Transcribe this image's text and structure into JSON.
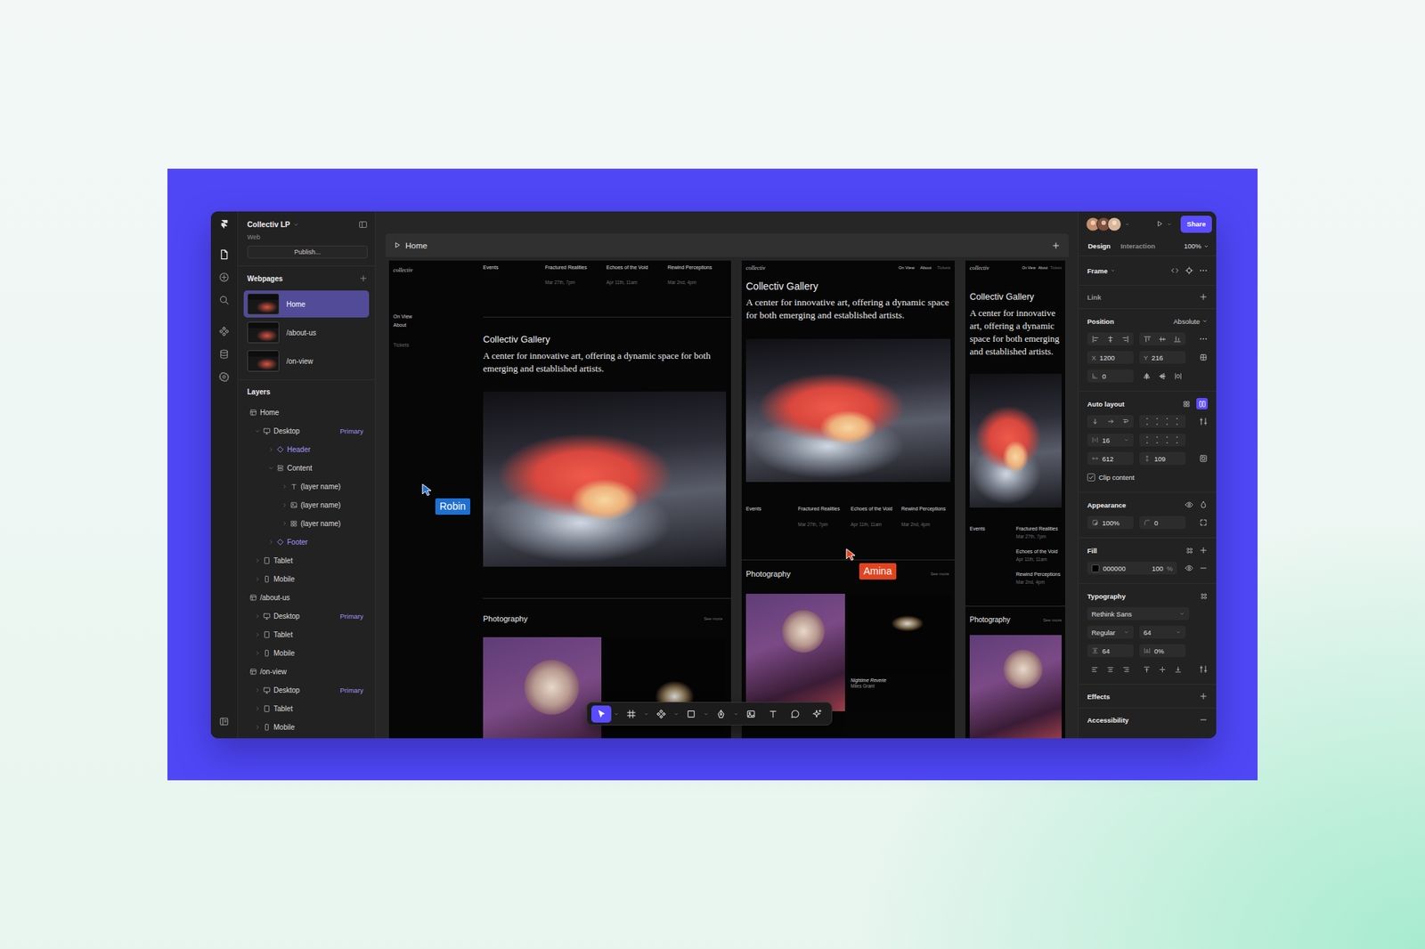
{
  "project": {
    "name": "Collectiv LP",
    "type": "Web",
    "publish": "Publish..."
  },
  "rail": [
    {
      "kind": "pages",
      "selected": true
    },
    {
      "kind": "insert",
      "selected": false
    },
    {
      "kind": "search",
      "selected": false
    },
    {
      "kind": "components",
      "selected": false
    },
    {
      "kind": "cms",
      "selected": false
    },
    {
      "kind": "settings",
      "selected": false
    },
    {
      "kind": "docs",
      "selected": false
    }
  ],
  "webpages": {
    "title": "Webpages",
    "pages": [
      {
        "name": "Home",
        "selected": true
      },
      {
        "name": "/about-us",
        "selected": false
      },
      {
        "name": "/on-view",
        "selected": false
      }
    ]
  },
  "layers": {
    "title": "Layers",
    "items": [
      {
        "name": "Home",
        "kind": "page",
        "depth": 0,
        "expanded": true,
        "tag": ""
      },
      {
        "name": "Desktop",
        "kind": "desktop",
        "depth": 1,
        "expanded": true,
        "tag": "Primary"
      },
      {
        "name": "Header",
        "kind": "component",
        "depth": 2,
        "expanded": false,
        "tag": ""
      },
      {
        "name": "Content",
        "kind": "stack",
        "depth": 2,
        "expanded": true,
        "tag": ""
      },
      {
        "name": "(layer name)",
        "kind": "text",
        "depth": 3,
        "expanded": false,
        "tag": ""
      },
      {
        "name": "(layer name)",
        "kind": "image",
        "depth": 3,
        "expanded": false,
        "tag": ""
      },
      {
        "name": "(layer name)",
        "kind": "grid",
        "depth": 3,
        "expanded": false,
        "tag": ""
      },
      {
        "name": "Footer",
        "kind": "component",
        "depth": 2,
        "expanded": false,
        "tag": ""
      },
      {
        "name": "Tablet",
        "kind": "tablet",
        "depth": 1,
        "expanded": false,
        "tag": ""
      },
      {
        "name": "Mobile",
        "kind": "mobile",
        "depth": 1,
        "expanded": false,
        "tag": ""
      },
      {
        "name": "/about-us",
        "kind": "page",
        "depth": 0,
        "expanded": true,
        "tag": ""
      },
      {
        "name": "Desktop",
        "kind": "desktop",
        "depth": 1,
        "expanded": false,
        "tag": "Primary"
      },
      {
        "name": "Tablet",
        "kind": "tablet",
        "depth": 1,
        "expanded": false,
        "tag": ""
      },
      {
        "name": "Mobile",
        "kind": "mobile",
        "depth": 1,
        "expanded": false,
        "tag": ""
      },
      {
        "name": "/on-view",
        "kind": "page",
        "depth": 0,
        "expanded": true,
        "tag": ""
      },
      {
        "name": "Desktop",
        "kind": "desktop",
        "depth": 1,
        "expanded": false,
        "tag": "Primary"
      },
      {
        "name": "Tablet",
        "kind": "tablet",
        "depth": 1,
        "expanded": false,
        "tag": ""
      },
      {
        "name": "Mobile",
        "kind": "mobile",
        "depth": 1,
        "expanded": false,
        "tag": ""
      }
    ]
  },
  "canvas": {
    "title": "Home",
    "frames": [
      {
        "kind": "desktop"
      },
      {
        "kind": "tablet"
      },
      {
        "kind": "mobile"
      }
    ],
    "site": {
      "logo": "collectiv",
      "nav": [
        {
          "label": "On View",
          "muted": false
        },
        {
          "label": "About",
          "muted": false
        },
        {
          "label": "Tickets",
          "muted": true
        }
      ],
      "title": "Collectiv Gallery",
      "tagline": "A center for innovative art, offering a dynamic space for both emerging and established artists.",
      "events_label": "Events",
      "events": [
        {
          "title": "Fractured Realities",
          "date": "Mar 27th, 7pm"
        },
        {
          "title": "Echoes of the Void",
          "date": "Apr 11th, 11am"
        },
        {
          "title": "Rewind Perceptions",
          "date": "Mar 2nd, 4pm"
        }
      ],
      "section": "Photography",
      "more": "See more",
      "caption": {
        "title": "Nightime Reverie",
        "artist": "Miles Grant"
      }
    },
    "cursors": [
      {
        "name": "Robin",
        "color": "#1f6fd1"
      },
      {
        "name": "Amina",
        "color": "#e2431f"
      }
    ],
    "tools": [
      {
        "kind": "select",
        "selected": true,
        "menu": true
      },
      {
        "kind": "frame",
        "selected": false,
        "menu": true
      },
      {
        "kind": "component",
        "selected": false,
        "menu": true
      },
      {
        "kind": "shape",
        "selected": false,
        "menu": true
      },
      {
        "kind": "pen",
        "selected": false,
        "menu": true
      },
      {
        "kind": "image",
        "selected": false,
        "menu": false
      },
      {
        "kind": "text",
        "selected": false,
        "menu": false
      },
      {
        "kind": "comment",
        "selected": false,
        "menu": false
      },
      {
        "kind": "ai",
        "selected": false,
        "menu": false
      }
    ]
  },
  "inspector": {
    "collaborators": [
      {
        "color": "#c58f6e"
      },
      {
        "color": "#7d4f3c"
      },
      {
        "color": "#d8b69a"
      }
    ],
    "share": "Share",
    "tabs": [
      {
        "label": "Design",
        "selected": true
      },
      {
        "label": "Interaction",
        "selected": false
      }
    ],
    "zoom": "100%",
    "frame": {
      "title": "Frame"
    },
    "link": {
      "title": "Link"
    },
    "position": {
      "title": "Position",
      "mode": "Absolute",
      "x": {
        "label": "X",
        "value": "1200"
      },
      "y": {
        "label": "Y",
        "value": "216"
      },
      "rotation": "0"
    },
    "auto_layout": {
      "title": "Auto layout",
      "enabled": true,
      "gap": "16",
      "width": "612",
      "height": "109",
      "clip": {
        "label": "Clip content",
        "checked": true
      }
    },
    "appearance": {
      "title": "Appearance",
      "opacity": "100%",
      "radius": "0"
    },
    "fill": {
      "title": "Fill",
      "hex": "000000",
      "opacity": "100",
      "unit": "%"
    },
    "typography": {
      "title": "Typography",
      "font": "Rethink Sans",
      "weight": "Regular",
      "size": "64",
      "line_height": "64",
      "letter_spacing": "0%"
    },
    "effects": {
      "title": "Effects"
    },
    "accessibility": {
      "title": "Accessibility"
    }
  }
}
